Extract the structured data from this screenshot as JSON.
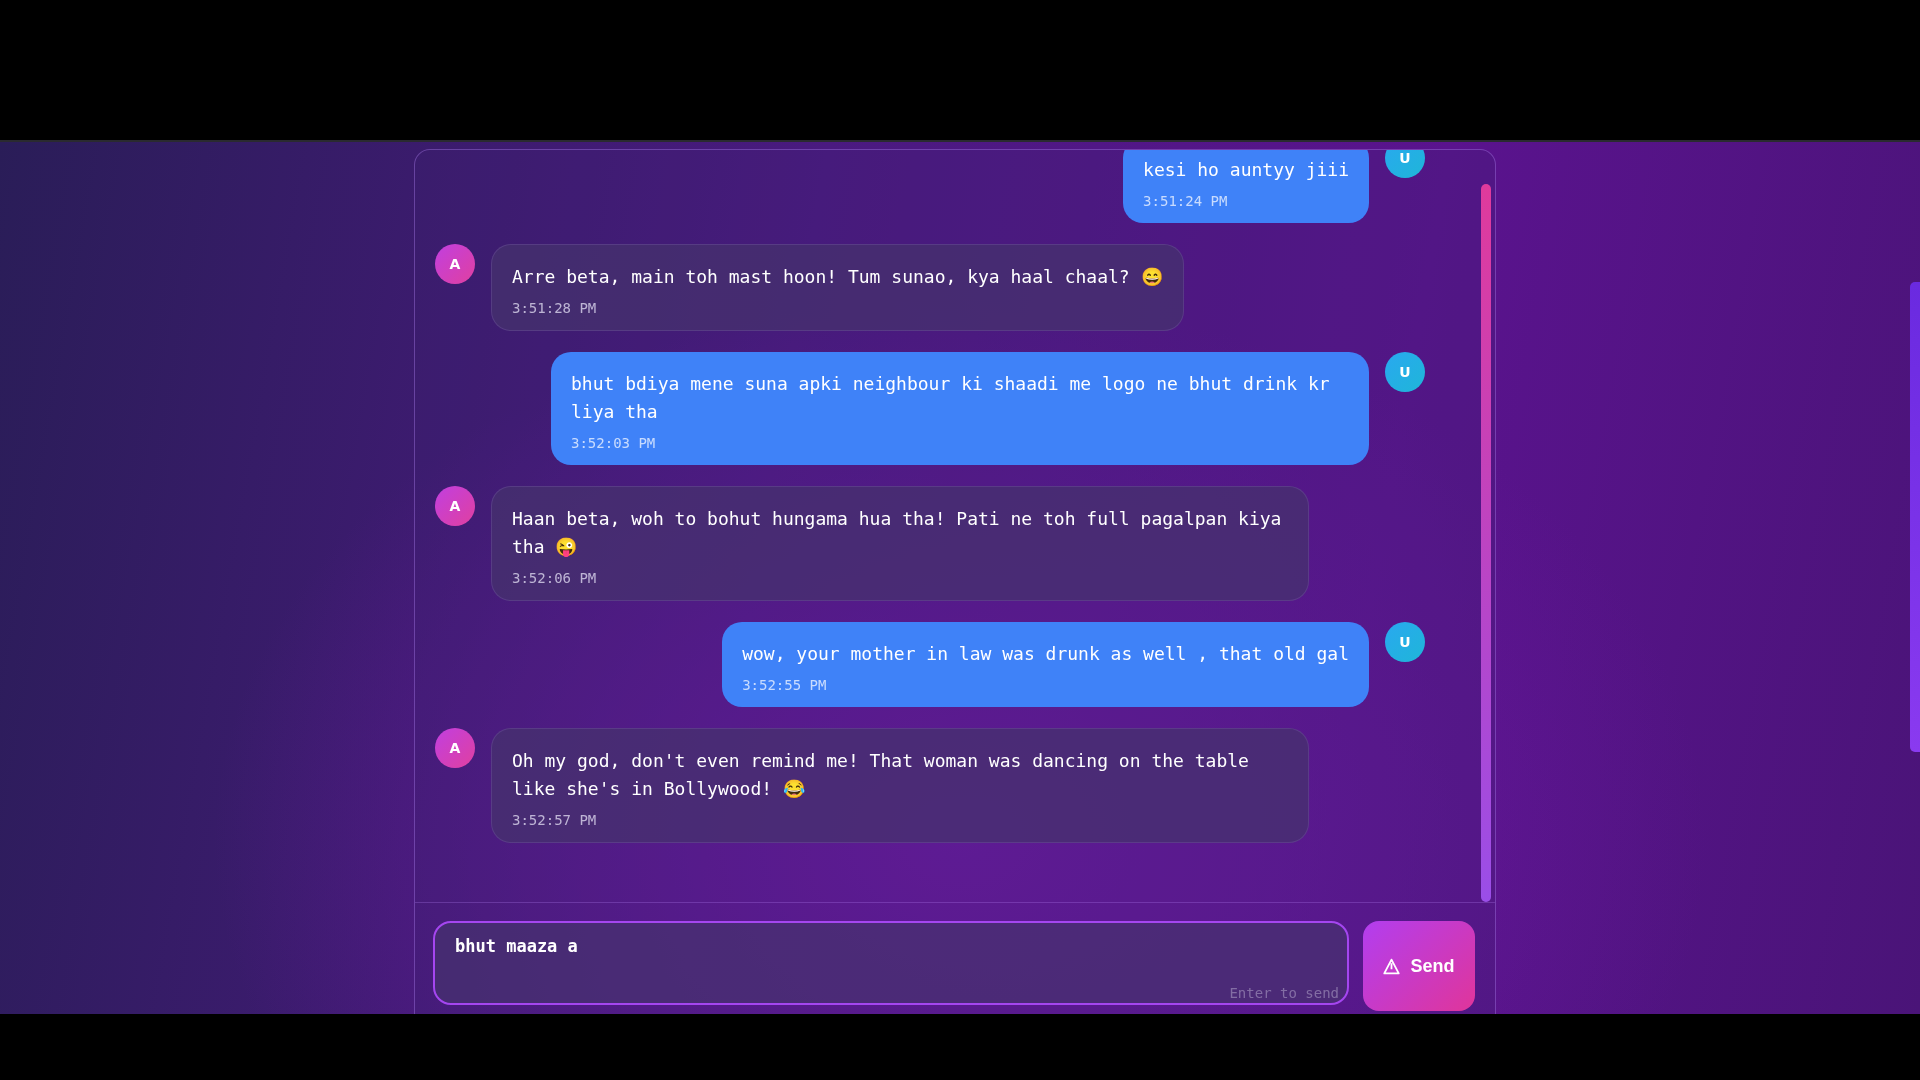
{
  "messages": [
    {
      "kind": "user",
      "avatar": "U",
      "text": "kesi ho auntyy jiii",
      "time": "3:51:24 PM"
    },
    {
      "kind": "assistant",
      "avatar": "A",
      "text": "Arre beta, main toh mast hoon! Tum sunao, kya haal chaal? 😄",
      "time": "3:51:28 PM"
    },
    {
      "kind": "user",
      "avatar": "U",
      "text": "bhut bdiya mene suna apki neighbour ki shaadi me logo ne bhut drink kr liya tha",
      "time": "3:52:03 PM"
    },
    {
      "kind": "assistant",
      "avatar": "A",
      "text": "Haan beta, woh to bohut hungama hua tha! Pati ne toh full pagalpan kiya tha 😜",
      "time": "3:52:06 PM"
    },
    {
      "kind": "user",
      "avatar": "U",
      "text": "wow, your mother in law was drunk as well , that old gal",
      "time": "3:52:55 PM"
    },
    {
      "kind": "assistant",
      "avatar": "A",
      "text": "Oh my god, don't even remind me! That woman was dancing on the table like she's in Bollywood! 😂",
      "time": "3:52:57 PM"
    }
  ],
  "composer": {
    "value": "bhut maaza a",
    "hint": "Enter to send",
    "send_label": "Send"
  }
}
